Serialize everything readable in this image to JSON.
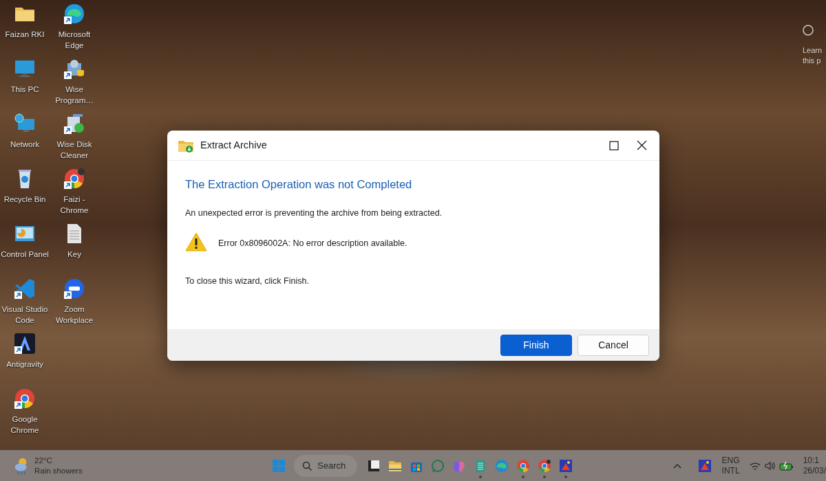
{
  "desktop": {
    "icons": [
      {
        "label": "Faizan RKI",
        "kind": "folder"
      },
      {
        "label": "This PC",
        "kind": "pc"
      },
      {
        "label": "Network",
        "kind": "network"
      },
      {
        "label": "Recycle Bin",
        "kind": "recycle"
      },
      {
        "label": "Control Panel",
        "kind": "control"
      },
      {
        "label": "Visual Studio Code",
        "kind": "vscode"
      },
      {
        "label": "Antigravity",
        "kind": "antigravity"
      },
      {
        "label": "Google Chrome",
        "kind": "chrome"
      },
      {
        "label": "Microsoft Edge",
        "kind": "edge"
      },
      {
        "label": "Wise Program…",
        "kind": "wiseprog"
      },
      {
        "label": "Wise Disk Cleaner",
        "kind": "wisedisk"
      },
      {
        "label": "Faizi - Chrome",
        "kind": "chromeprofile"
      },
      {
        "label": "Key",
        "kind": "document"
      },
      {
        "label": "Zoom Workplace",
        "kind": "zoom"
      }
    ],
    "corner_widget": {
      "lines": [
        "Learn",
        "this p"
      ]
    }
  },
  "dialog": {
    "title": "Extract Archive",
    "heading": "The Extraction Operation was not Completed",
    "message": "An unexpected error is preventing the archive from being extracted.",
    "error": "Error 0x8096002A: No error description available.",
    "instruction": "To close this wizard, click Finish.",
    "buttons": [
      {
        "label": "Finish",
        "primary": true
      },
      {
        "label": "Cancel",
        "primary": false
      }
    ]
  },
  "taskbar": {
    "weather": {
      "temperature": "22°C",
      "condition": "Rain showers"
    },
    "search": {
      "label": "Search"
    },
    "apps": [
      {
        "kind": "taskview",
        "running": false
      },
      {
        "kind": "explorer",
        "running": false
      },
      {
        "kind": "store",
        "running": false
      },
      {
        "kind": "whatsapp",
        "running": false
      },
      {
        "kind": "copilot",
        "running": false
      },
      {
        "kind": "notepad",
        "running": true
      },
      {
        "kind": "edge",
        "running": false
      },
      {
        "kind": "chrome",
        "running": true
      },
      {
        "kind": "chromeprofile",
        "running": true
      },
      {
        "kind": "game",
        "running": true
      }
    ],
    "tray": {
      "language": "ENG",
      "layout": "INTL",
      "time": "10:1",
      "date": "26/03/"
    }
  }
}
